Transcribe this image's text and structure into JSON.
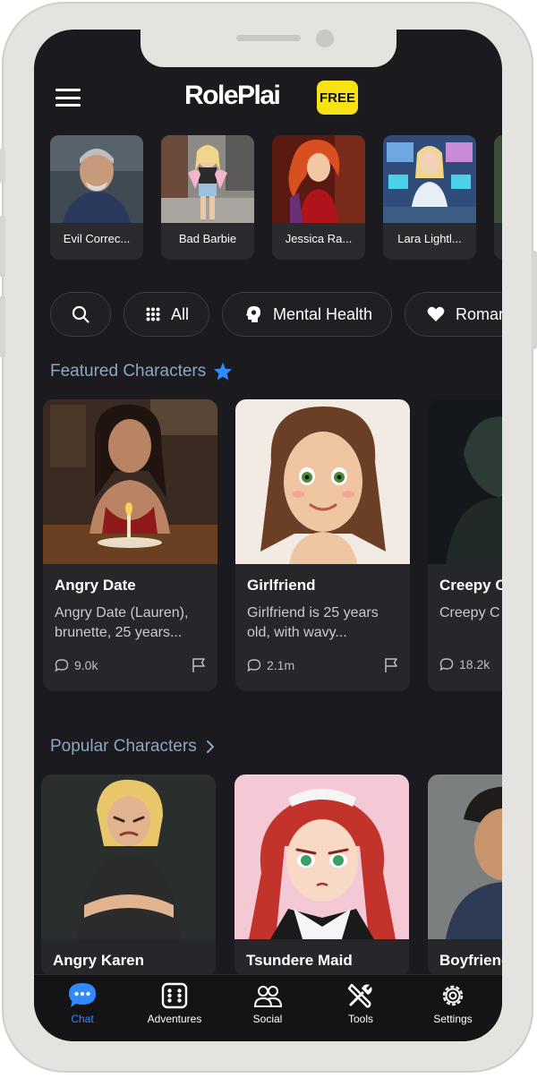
{
  "app": {
    "logo_text": "RolePlai",
    "badge": "FREE",
    "accent": "#2f8bff",
    "badge_color": "#f7e214"
  },
  "recent": [
    {
      "name": "Evil Correc..."
    },
    {
      "name": "Bad Barbie"
    },
    {
      "name": "Jessica Ra..."
    },
    {
      "name": "Lara Lightl..."
    }
  ],
  "chips": [
    {
      "icon": "search-icon",
      "label": ""
    },
    {
      "icon": "grid-icon",
      "label": "All"
    },
    {
      "icon": "head-icon",
      "label": "Mental Health"
    },
    {
      "icon": "heart-icon",
      "label": "Romar"
    }
  ],
  "featured": {
    "title": "Featured Characters",
    "cards": [
      {
        "name": "Angry Date",
        "desc": "Angry Date (Lauren), brunette, 25 years...",
        "chats": "9.0k"
      },
      {
        "name": "Girlfriend",
        "desc": "Girlfriend is 25 years old, with wavy...",
        "chats": "2.1m"
      },
      {
        "name": "Creepy C",
        "desc": "Creepy C desperat",
        "chats": "18.2k"
      }
    ]
  },
  "popular": {
    "title": "Popular Characters",
    "cards": [
      {
        "name": "Angry Karen"
      },
      {
        "name": "Tsundere Maid"
      },
      {
        "name": "Boyfriend"
      }
    ]
  },
  "tabs": [
    {
      "label": "Chat",
      "icon": "chat-bubble-icon",
      "active": true
    },
    {
      "label": "Adventures",
      "icon": "dice-icon",
      "active": false
    },
    {
      "label": "Social",
      "icon": "people-icon",
      "active": false
    },
    {
      "label": "Tools",
      "icon": "tools-icon",
      "active": false
    },
    {
      "label": "Settings",
      "icon": "gear-icon",
      "active": false
    }
  ]
}
